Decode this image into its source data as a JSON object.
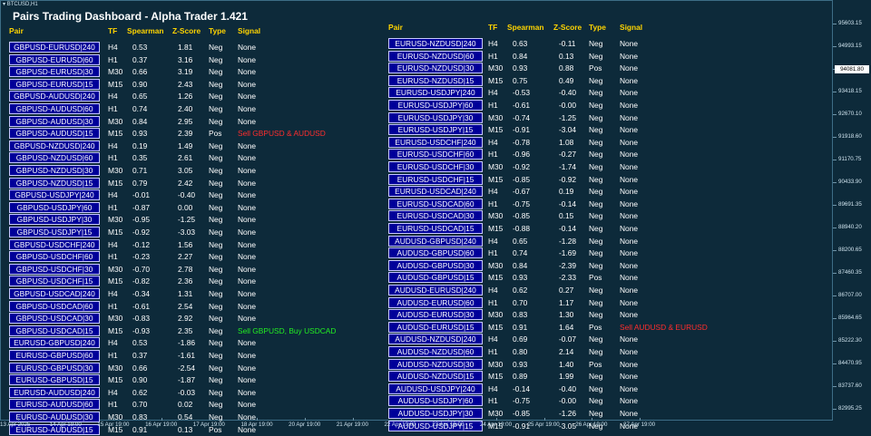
{
  "window": {
    "symbol_label": "BTCUSD,H1"
  },
  "dashboard": {
    "title": "Pairs Trading Dashboard - Alpha Trader 1.421",
    "headers": {
      "pair": "Pair",
      "tf": "TF",
      "spearman": "Spearman",
      "zscore": "Z-Score",
      "type": "Type",
      "signal": "Signal"
    },
    "left_rows": [
      {
        "pair": "GBPUSD-EURUSD|240",
        "tf": "H4",
        "spearman": "0.53",
        "zscore": "1.81",
        "type": "Neg",
        "signal": "None",
        "sig": ""
      },
      {
        "pair": "GBPUSD-EURUSD|60",
        "tf": "H1",
        "spearman": "0.37",
        "zscore": "3.16",
        "type": "Neg",
        "signal": "None",
        "sig": ""
      },
      {
        "pair": "GBPUSD-EURUSD|30",
        "tf": "M30",
        "spearman": "0.66",
        "zscore": "3.19",
        "type": "Neg",
        "signal": "None",
        "sig": ""
      },
      {
        "pair": "GBPUSD-EURUSD|15",
        "tf": "M15",
        "spearman": "0.90",
        "zscore": "2.43",
        "type": "Neg",
        "signal": "None",
        "sig": ""
      },
      {
        "pair": "GBPUSD-AUDUSD|240",
        "tf": "H4",
        "spearman": "0.65",
        "zscore": "1.26",
        "type": "Neg",
        "signal": "None",
        "sig": ""
      },
      {
        "pair": "GBPUSD-AUDUSD|60",
        "tf": "H1",
        "spearman": "0.74",
        "zscore": "2.40",
        "type": "Neg",
        "signal": "None",
        "sig": ""
      },
      {
        "pair": "GBPUSD-AUDUSD|30",
        "tf": "M30",
        "spearman": "0.84",
        "zscore": "2.95",
        "type": "Neg",
        "signal": "None",
        "sig": ""
      },
      {
        "pair": "GBPUSD-AUDUSD|15",
        "tf": "M15",
        "spearman": "0.93",
        "zscore": "2.39",
        "type": "Pos",
        "signal": "Sell GBPUSD & AUDUSD",
        "sig": "red"
      },
      {
        "pair": "GBPUSD-NZDUSD|240",
        "tf": "H4",
        "spearman": "0.19",
        "zscore": "1.49",
        "type": "Neg",
        "signal": "None",
        "sig": ""
      },
      {
        "pair": "GBPUSD-NZDUSD|60",
        "tf": "H1",
        "spearman": "0.35",
        "zscore": "2.61",
        "type": "Neg",
        "signal": "None",
        "sig": ""
      },
      {
        "pair": "GBPUSD-NZDUSD|30",
        "tf": "M30",
        "spearman": "0.71",
        "zscore": "3.05",
        "type": "Neg",
        "signal": "None",
        "sig": ""
      },
      {
        "pair": "GBPUSD-NZDUSD|15",
        "tf": "M15",
        "spearman": "0.79",
        "zscore": "2.42",
        "type": "Neg",
        "signal": "None",
        "sig": ""
      },
      {
        "pair": "GBPUSD-USDJPY|240",
        "tf": "H4",
        "spearman": "-0.01",
        "zscore": "-0.40",
        "type": "Neg",
        "signal": "None",
        "sig": ""
      },
      {
        "pair": "GBPUSD-USDJPY|60",
        "tf": "H1",
        "spearman": "-0.87",
        "zscore": "0.00",
        "type": "Neg",
        "signal": "None",
        "sig": ""
      },
      {
        "pair": "GBPUSD-USDJPY|30",
        "tf": "M30",
        "spearman": "-0.95",
        "zscore": "-1.25",
        "type": "Neg",
        "signal": "None",
        "sig": ""
      },
      {
        "pair": "GBPUSD-USDJPY|15",
        "tf": "M15",
        "spearman": "-0.92",
        "zscore": "-3.03",
        "type": "Neg",
        "signal": "None",
        "sig": ""
      },
      {
        "pair": "GBPUSD-USDCHF|240",
        "tf": "H4",
        "spearman": "-0.12",
        "zscore": "1.56",
        "type": "Neg",
        "signal": "None",
        "sig": ""
      },
      {
        "pair": "GBPUSD-USDCHF|60",
        "tf": "H1",
        "spearman": "-0.23",
        "zscore": "2.27",
        "type": "Neg",
        "signal": "None",
        "sig": ""
      },
      {
        "pair": "GBPUSD-USDCHF|30",
        "tf": "M30",
        "spearman": "-0.70",
        "zscore": "2.78",
        "type": "Neg",
        "signal": "None",
        "sig": ""
      },
      {
        "pair": "GBPUSD-USDCHF|15",
        "tf": "M15",
        "spearman": "-0.82",
        "zscore": "2.36",
        "type": "Neg",
        "signal": "None",
        "sig": ""
      },
      {
        "pair": "GBPUSD-USDCAD|240",
        "tf": "H4",
        "spearman": "-0.34",
        "zscore": "1.31",
        "type": "Neg",
        "signal": "None",
        "sig": ""
      },
      {
        "pair": "GBPUSD-USDCAD|60",
        "tf": "H1",
        "spearman": "-0.61",
        "zscore": "2.54",
        "type": "Neg",
        "signal": "None",
        "sig": ""
      },
      {
        "pair": "GBPUSD-USDCAD|30",
        "tf": "M30",
        "spearman": "-0.83",
        "zscore": "2.92",
        "type": "Neg",
        "signal": "None",
        "sig": ""
      },
      {
        "pair": "GBPUSD-USDCAD|15",
        "tf": "M15",
        "spearman": "-0.93",
        "zscore": "2.35",
        "type": "Neg",
        "signal": "Sell GBPUSD, Buy USDCAD",
        "sig": "green"
      },
      {
        "pair": "EURUSD-GBPUSD|240",
        "tf": "H4",
        "spearman": "0.53",
        "zscore": "-1.86",
        "type": "Neg",
        "signal": "None",
        "sig": ""
      },
      {
        "pair": "EURUSD-GBPUSD|60",
        "tf": "H1",
        "spearman": "0.37",
        "zscore": "-1.61",
        "type": "Neg",
        "signal": "None",
        "sig": ""
      },
      {
        "pair": "EURUSD-GBPUSD|30",
        "tf": "M30",
        "spearman": "0.66",
        "zscore": "-2.54",
        "type": "Neg",
        "signal": "None",
        "sig": ""
      },
      {
        "pair": "EURUSD-GBPUSD|15",
        "tf": "M15",
        "spearman": "0.90",
        "zscore": "-1.87",
        "type": "Neg",
        "signal": "None",
        "sig": ""
      },
      {
        "pair": "EURUSD-AUDUSD|240",
        "tf": "H4",
        "spearman": "0.62",
        "zscore": "-0.03",
        "type": "Neg",
        "signal": "None",
        "sig": ""
      },
      {
        "pair": "EURUSD-AUDUSD|60",
        "tf": "H1",
        "spearman": "0.70",
        "zscore": "0.02",
        "type": "Neg",
        "signal": "None",
        "sig": ""
      },
      {
        "pair": "EURUSD-AUDUSD|30",
        "tf": "M30",
        "spearman": "0.83",
        "zscore": "0.54",
        "type": "Neg",
        "signal": "None",
        "sig": ""
      },
      {
        "pair": "EURUSD-AUDUSD|15",
        "tf": "M15",
        "spearman": "0.91",
        "zscore": "0.13",
        "type": "Pos",
        "signal": "None",
        "sig": ""
      }
    ],
    "right_rows": [
      {
        "pair": "EURUSD-NZDUSD|240",
        "tf": "H4",
        "spearman": "0.63",
        "zscore": "-0.11",
        "type": "Neg",
        "signal": "None",
        "sig": ""
      },
      {
        "pair": "EURUSD-NZDUSD|60",
        "tf": "H1",
        "spearman": "0.84",
        "zscore": "0.13",
        "type": "Neg",
        "signal": "None",
        "sig": ""
      },
      {
        "pair": "EURUSD-NZDUSD|30",
        "tf": "M30",
        "spearman": "0.93",
        "zscore": "0.88",
        "type": "Pos",
        "signal": "None",
        "sig": ""
      },
      {
        "pair": "EURUSD-NZDUSD|15",
        "tf": "M15",
        "spearman": "0.75",
        "zscore": "0.49",
        "type": "Neg",
        "signal": "None",
        "sig": ""
      },
      {
        "pair": "EURUSD-USDJPY|240",
        "tf": "H4",
        "spearman": "-0.53",
        "zscore": "-0.40",
        "type": "Neg",
        "signal": "None",
        "sig": ""
      },
      {
        "pair": "EURUSD-USDJPY|60",
        "tf": "H1",
        "spearman": "-0.61",
        "zscore": "-0.00",
        "type": "Neg",
        "signal": "None",
        "sig": ""
      },
      {
        "pair": "EURUSD-USDJPY|30",
        "tf": "M30",
        "spearman": "-0.74",
        "zscore": "-1.25",
        "type": "Neg",
        "signal": "None",
        "sig": ""
      },
      {
        "pair": "EURUSD-USDJPY|15",
        "tf": "M15",
        "spearman": "-0.91",
        "zscore": "-3.04",
        "type": "Neg",
        "signal": "None",
        "sig": ""
      },
      {
        "pair": "EURUSD-USDCHF|240",
        "tf": "H4",
        "spearman": "-0.78",
        "zscore": "1.08",
        "type": "Neg",
        "signal": "None",
        "sig": ""
      },
      {
        "pair": "EURUSD-USDCHF|60",
        "tf": "H1",
        "spearman": "-0.96",
        "zscore": "-0.27",
        "type": "Neg",
        "signal": "None",
        "sig": ""
      },
      {
        "pair": "EURUSD-USDCHF|30",
        "tf": "M30",
        "spearman": "-0.92",
        "zscore": "-1.74",
        "type": "Neg",
        "signal": "None",
        "sig": ""
      },
      {
        "pair": "EURUSD-USDCHF|15",
        "tf": "M15",
        "spearman": "-0.85",
        "zscore": "-0.92",
        "type": "Neg",
        "signal": "None",
        "sig": ""
      },
      {
        "pair": "EURUSD-USDCAD|240",
        "tf": "H4",
        "spearman": "-0.67",
        "zscore": "0.19",
        "type": "Neg",
        "signal": "None",
        "sig": ""
      },
      {
        "pair": "EURUSD-USDCAD|60",
        "tf": "H1",
        "spearman": "-0.75",
        "zscore": "-0.14",
        "type": "Neg",
        "signal": "None",
        "sig": ""
      },
      {
        "pair": "EURUSD-USDCAD|30",
        "tf": "M30",
        "spearman": "-0.85",
        "zscore": "0.15",
        "type": "Neg",
        "signal": "None",
        "sig": ""
      },
      {
        "pair": "EURUSD-USDCAD|15",
        "tf": "M15",
        "spearman": "-0.88",
        "zscore": "-0.14",
        "type": "Neg",
        "signal": "None",
        "sig": ""
      },
      {
        "pair": "AUDUSD-GBPUSD|240",
        "tf": "H4",
        "spearman": "0.65",
        "zscore": "-1.28",
        "type": "Neg",
        "signal": "None",
        "sig": ""
      },
      {
        "pair": "AUDUSD-GBPUSD|60",
        "tf": "H1",
        "spearman": "0.74",
        "zscore": "-1.69",
        "type": "Neg",
        "signal": "None",
        "sig": ""
      },
      {
        "pair": "AUDUSD-GBPUSD|30",
        "tf": "M30",
        "spearman": "0.84",
        "zscore": "-2.39",
        "type": "Neg",
        "signal": "None",
        "sig": ""
      },
      {
        "pair": "AUDUSD-GBPUSD|15",
        "tf": "M15",
        "spearman": "0.93",
        "zscore": "-2.33",
        "type": "Pos",
        "signal": "None",
        "sig": ""
      },
      {
        "pair": "AUDUSD-EURUSD|240",
        "tf": "H4",
        "spearman": "0.62",
        "zscore": "0.27",
        "type": "Neg",
        "signal": "None",
        "sig": ""
      },
      {
        "pair": "AUDUSD-EURUSD|60",
        "tf": "H1",
        "spearman": "0.70",
        "zscore": "1.17",
        "type": "Neg",
        "signal": "None",
        "sig": ""
      },
      {
        "pair": "AUDUSD-EURUSD|30",
        "tf": "M30",
        "spearman": "0.83",
        "zscore": "1.30",
        "type": "Neg",
        "signal": "None",
        "sig": ""
      },
      {
        "pair": "AUDUSD-EURUSD|15",
        "tf": "M15",
        "spearman": "0.91",
        "zscore": "1.64",
        "type": "Pos",
        "signal": "Sell AUDUSD & EURUSD",
        "sig": "red"
      },
      {
        "pair": "AUDUSD-NZDUSD|240",
        "tf": "H4",
        "spearman": "0.69",
        "zscore": "-0.07",
        "type": "Neg",
        "signal": "None",
        "sig": ""
      },
      {
        "pair": "AUDUSD-NZDUSD|60",
        "tf": "H1",
        "spearman": "0.80",
        "zscore": "2.14",
        "type": "Neg",
        "signal": "None",
        "sig": ""
      },
      {
        "pair": "AUDUSD-NZDUSD|30",
        "tf": "M30",
        "spearman": "0.93",
        "zscore": "1.40",
        "type": "Pos",
        "signal": "None",
        "sig": ""
      },
      {
        "pair": "AUDUSD-NZDUSD|15",
        "tf": "M15",
        "spearman": "0.89",
        "zscore": "1.99",
        "type": "Neg",
        "signal": "None",
        "sig": ""
      },
      {
        "pair": "AUDUSD-USDJPY|240",
        "tf": "H4",
        "spearman": "-0.14",
        "zscore": "-0.40",
        "type": "Neg",
        "signal": "None",
        "sig": ""
      },
      {
        "pair": "AUDUSD-USDJPY|60",
        "tf": "H1",
        "spearman": "-0.75",
        "zscore": "-0.00",
        "type": "Neg",
        "signal": "None",
        "sig": ""
      },
      {
        "pair": "AUDUSD-USDJPY|30",
        "tf": "M30",
        "spearman": "-0.85",
        "zscore": "-1.26",
        "type": "Neg",
        "signal": "None",
        "sig": ""
      },
      {
        "pair": "AUDUSD-USDJPY|15",
        "tf": "M15",
        "spearman": "-0.91",
        "zscore": "-3.05",
        "type": "Neg",
        "signal": "None",
        "sig": ""
      }
    ]
  },
  "price_axis": {
    "labels": [
      "95603.15",
      "94993.15",
      "94081.80",
      "93418.15",
      "92670.10",
      "91918.60",
      "91170.75",
      "90433.90",
      "89691.35",
      "88940.20",
      "88200.65",
      "87460.35",
      "86707.00",
      "85964.65",
      "85222.30",
      "84470.95",
      "83737.60",
      "82995.25"
    ],
    "current_price": "94081.80"
  },
  "time_axis": {
    "labels": [
      "13 Apr 2025",
      "14 Apr 19:00",
      "15 Apr 19:00",
      "16 Apr 19:00",
      "17 Apr 19:00",
      "18 Apr 19:00",
      "20 Apr 19:00",
      "21 Apr 19:00",
      "22 Apr 19:00",
      "23 Apr 19:00",
      "24 Apr 19:00",
      "25 Apr 19:00",
      "26 Apr 19:00",
      "27 Apr 19:00"
    ]
  },
  "colors": {
    "background": "#0d2a3a",
    "header": "#ffd400",
    "button": "#000099",
    "sell": "#ff2d2d",
    "buy": "#22ee22"
  }
}
